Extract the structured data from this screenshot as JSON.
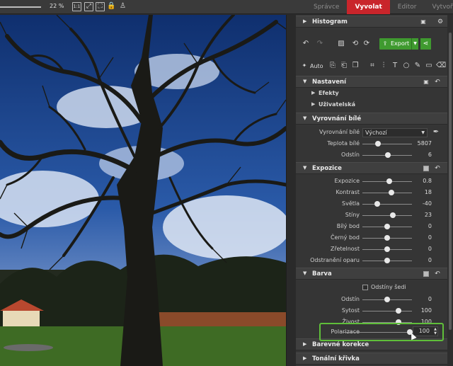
{
  "topbar": {
    "zoom_value": "22 %",
    "icons": [
      "fit-1-1-icon",
      "fit-screen-icon",
      "fullscreen-icon",
      "lock-icon",
      "magic-person-icon"
    ],
    "icon_labels": {
      "one_to_one": "1:1"
    }
  },
  "tabs": [
    {
      "label": "Správce",
      "active": false
    },
    {
      "label": "Vyvolat",
      "active": true
    },
    {
      "label": "Editor",
      "active": false
    },
    {
      "label": "Vytvořit",
      "active": false
    }
  ],
  "panel": {
    "histogram": {
      "title": "Histogram"
    },
    "export_label": "Export",
    "auto_label": "Auto",
    "nastaveni": {
      "title": "Nastavení",
      "items": [
        {
          "label": "Efekty"
        },
        {
          "label": "Uživatelská"
        }
      ]
    },
    "white_balance": {
      "title": "Vyrovnání bílé",
      "select_label": "Vyrovnání bílé",
      "select_value": "Výchozí",
      "sliders": [
        {
          "label": "Teplota bílé",
          "value": "5807",
          "pos": 0.32
        },
        {
          "label": "Odstín",
          "value": "6",
          "pos": 0.52
        }
      ]
    },
    "exposure": {
      "title": "Expozice",
      "sliders": [
        {
          "label": "Expozice",
          "value": "0.8",
          "pos": 0.54
        },
        {
          "label": "Kontrast",
          "value": "18",
          "pos": 0.59
        },
        {
          "label": "Světla",
          "value": "-40",
          "pos": 0.3
        },
        {
          "label": "Stíny",
          "value": "23",
          "pos": 0.61
        },
        {
          "label": "Bílý bod",
          "value": "0",
          "pos": 0.5
        },
        {
          "label": "Černý bod",
          "value": "0",
          "pos": 0.5
        },
        {
          "label": "Zřetelnost",
          "value": "0",
          "pos": 0.5
        },
        {
          "label": "Odstranění oparu",
          "value": "0",
          "pos": 0.5
        }
      ]
    },
    "color": {
      "title": "Barva",
      "grayscale_label": "Odstíny šedi",
      "sliders": [
        {
          "label": "Odstín",
          "value": "0",
          "pos": 0.5
        },
        {
          "label": "Sytost",
          "value": "100",
          "pos": 0.73
        },
        {
          "label": "Živost",
          "value": "100",
          "pos": 0.73
        }
      ],
      "polarization": {
        "label": "Polarizace",
        "value": "100",
        "pos": 0.95
      }
    },
    "color_corrections": {
      "title": "Barevné korekce"
    },
    "tone_curve": {
      "title": "Tonální křivka"
    }
  },
  "colors": {
    "active_tab": "#c9252b",
    "export_green": "#3f9a2f",
    "highlight_green": "#5fbf3a"
  }
}
